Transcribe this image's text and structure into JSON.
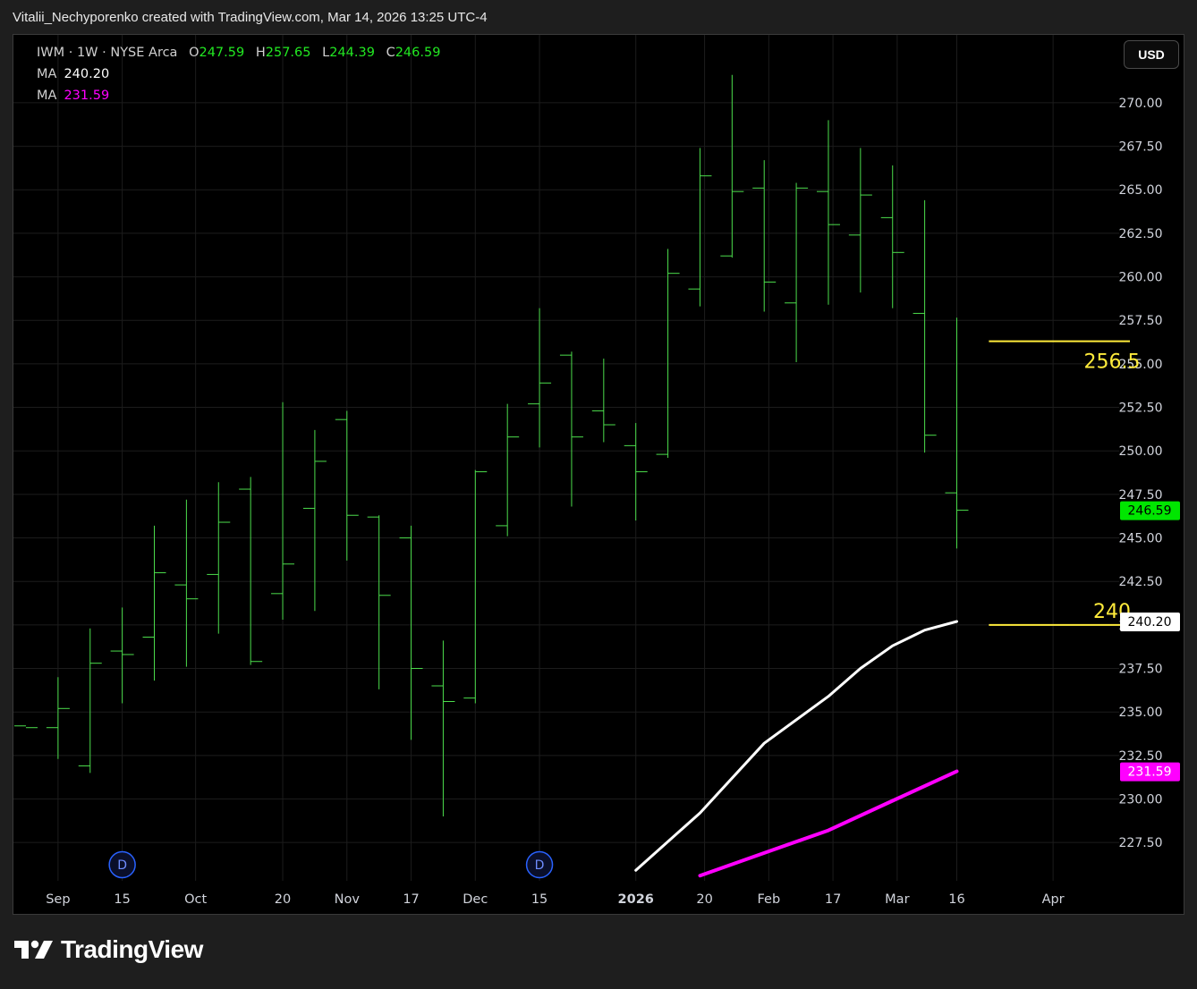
{
  "header": {
    "attribution": "Vitalii_Nechyporenko created with TradingView.com, Mar 14, 2026 13:25 UTC-4"
  },
  "legend": {
    "symbol": "IWM · 1W · NYSE Arca",
    "ohlc": {
      "o_label": "O",
      "o_value": "247.59",
      "h_label": "H",
      "h_value": "257.65",
      "l_label": "L",
      "l_value": "244.39",
      "c_label": "C",
      "c_value": "246.59"
    },
    "ma1_label": "MA",
    "ma1_value": "240.20",
    "ma2_label": "MA",
    "ma2_value": "231.59"
  },
  "toolbar": {
    "currency_button": "USD"
  },
  "branding": {
    "logo_text": "TradingView"
  },
  "colors": {
    "background": "#000000",
    "bar": "#4cdd4c",
    "ma1": "#ffffff",
    "ma2": "#ff00ff",
    "horizontal_line": "#ffeb3b",
    "last_price_badge": "#00e600",
    "dividend_marker": "#2962ff",
    "grid": "#1c1c1c"
  },
  "chart_data": {
    "type": "ohlc",
    "symbol": "IWM",
    "interval": "1W",
    "grid": true,
    "y_axis": {
      "range": [
        225.3,
        273.9
      ],
      "ticks": [
        "227.50",
        "230.00",
        "232.50",
        "235.00",
        "237.50",
        "240.00",
        "242.50",
        "245.00",
        "247.50",
        "250.00",
        "252.50",
        "255.00",
        "257.50",
        "260.00",
        "262.50",
        "265.00",
        "267.50",
        "270.00"
      ]
    },
    "x_axis": {
      "start": "2025-08-25",
      "end": "2026-04-13",
      "ticks": [
        {
          "label": "Sep",
          "date": "2025-09-01"
        },
        {
          "label": "15",
          "date": "2025-09-15"
        },
        {
          "label": "Oct",
          "date": "2025-10-01"
        },
        {
          "label": "20",
          "date": "2025-10-20"
        },
        {
          "label": "Nov",
          "date": "2025-11-03"
        },
        {
          "label": "17",
          "date": "2025-11-17"
        },
        {
          "label": "Dec",
          "date": "2025-12-01"
        },
        {
          "label": "15",
          "date": "2025-12-15"
        },
        {
          "label": "2026",
          "date": "2026-01-05"
        },
        {
          "label": "20",
          "date": "2026-01-20"
        },
        {
          "label": "Feb",
          "date": "2026-02-03"
        },
        {
          "label": "17",
          "date": "2026-02-17"
        },
        {
          "label": "Mar",
          "date": "2026-03-03"
        },
        {
          "label": "16",
          "date": "2026-03-16"
        },
        {
          "label": "Apr",
          "date": "2026-04-06"
        }
      ]
    },
    "bars": [
      {
        "date": "2025-08-25",
        "o": 234.2,
        "h": 234.2,
        "l": 234.2,
        "c": 234.1
      },
      {
        "date": "2025-09-01",
        "o": 234.1,
        "h": 237.0,
        "l": 232.3,
        "c": 235.2
      },
      {
        "date": "2025-09-08",
        "o": 231.9,
        "h": 239.8,
        "l": 231.5,
        "c": 237.8
      },
      {
        "date": "2025-09-15",
        "o": 238.5,
        "h": 241.0,
        "l": 235.5,
        "c": 238.3
      },
      {
        "date": "2025-09-22",
        "o": 239.3,
        "h": 245.7,
        "l": 236.8,
        "c": 243.0
      },
      {
        "date": "2025-09-29",
        "o": 242.3,
        "h": 247.2,
        "l": 237.6,
        "c": 241.5
      },
      {
        "date": "2025-10-06",
        "o": 242.9,
        "h": 248.2,
        "l": 239.5,
        "c": 245.9
      },
      {
        "date": "2025-10-13",
        "o": 247.8,
        "h": 248.5,
        "l": 237.7,
        "c": 237.9
      },
      {
        "date": "2025-10-20",
        "o": 241.8,
        "h": 252.8,
        "l": 240.3,
        "c": 243.5
      },
      {
        "date": "2025-10-27",
        "o": 246.7,
        "h": 251.2,
        "l": 240.8,
        "c": 249.4
      },
      {
        "date": "2025-11-03",
        "o": 251.8,
        "h": 252.3,
        "l": 243.7,
        "c": 246.3
      },
      {
        "date": "2025-11-10",
        "o": 246.2,
        "h": 246.3,
        "l": 236.3,
        "c": 241.7
      },
      {
        "date": "2025-11-17",
        "o": 245.0,
        "h": 245.7,
        "l": 233.4,
        "c": 237.5
      },
      {
        "date": "2025-11-24",
        "o": 236.5,
        "h": 239.1,
        "l": 229.0,
        "c": 235.6
      },
      {
        "date": "2025-12-01",
        "o": 235.8,
        "h": 248.9,
        "l": 235.5,
        "c": 248.8
      },
      {
        "date": "2025-12-08",
        "o": 245.7,
        "h": 252.7,
        "l": 245.1,
        "c": 250.8
      },
      {
        "date": "2025-12-15",
        "o": 252.7,
        "h": 258.2,
        "l": 250.2,
        "c": 253.9
      },
      {
        "date": "2025-12-22",
        "o": 255.5,
        "h": 255.7,
        "l": 246.8,
        "c": 250.8
      },
      {
        "date": "2025-12-29",
        "o": 252.3,
        "h": 255.3,
        "l": 250.5,
        "c": 251.5
      },
      {
        "date": "2026-01-05",
        "o": 250.3,
        "h": 251.6,
        "l": 246.0,
        "c": 248.8
      },
      {
        "date": "2026-01-12",
        "o": 249.8,
        "h": 261.6,
        "l": 249.6,
        "c": 260.2
      },
      {
        "date": "2026-01-19",
        "o": 259.3,
        "h": 267.4,
        "l": 258.3,
        "c": 265.8
      },
      {
        "date": "2026-01-26",
        "o": 261.2,
        "h": 271.6,
        "l": 261.1,
        "c": 264.9
      },
      {
        "date": "2026-02-02",
        "o": 265.1,
        "h": 266.7,
        "l": 258.0,
        "c": 259.7
      },
      {
        "date": "2026-02-09",
        "o": 258.5,
        "h": 265.4,
        "l": 255.1,
        "c": 265.1
      },
      {
        "date": "2026-02-16",
        "o": 264.9,
        "h": 269.0,
        "l": 258.4,
        "c": 263.0
      },
      {
        "date": "2026-02-23",
        "o": 262.4,
        "h": 267.4,
        "l": 259.1,
        "c": 264.7
      },
      {
        "date": "2026-03-02",
        "o": 263.4,
        "h": 266.4,
        "l": 258.2,
        "c": 261.4
      },
      {
        "date": "2026-03-09",
        "o": 257.9,
        "h": 264.4,
        "l": 249.9,
        "c": 250.9
      },
      {
        "date": "2026-03-16",
        "o": 247.59,
        "h": 257.65,
        "l": 244.39,
        "c": 246.59
      }
    ],
    "series": [
      {
        "name": "MA",
        "last_value": 240.2,
        "points": [
          {
            "date": "2026-01-05",
            "value": 225.9
          },
          {
            "date": "2026-01-19",
            "value": 229.2
          },
          {
            "date": "2026-02-02",
            "value": 233.2
          },
          {
            "date": "2026-02-16",
            "value": 235.9
          },
          {
            "date": "2026-02-23",
            "value": 237.5
          },
          {
            "date": "2026-03-02",
            "value": 238.8
          },
          {
            "date": "2026-03-09",
            "value": 239.7
          },
          {
            "date": "2026-03-16",
            "value": 240.2
          }
        ]
      },
      {
        "name": "MA",
        "last_value": 231.59,
        "points": [
          {
            "date": "2026-01-19",
            "value": 225.6
          },
          {
            "date": "2026-02-02",
            "value": 226.9
          },
          {
            "date": "2026-02-16",
            "value": 228.2
          },
          {
            "date": "2026-03-02",
            "value": 229.9
          },
          {
            "date": "2026-03-16",
            "value": 231.59
          }
        ]
      }
    ],
    "horizontal_lines": [
      {
        "value": 256.3,
        "label": "256.5",
        "start": "2026-03-23"
      },
      {
        "value": 240.0,
        "label": "240",
        "start": "2026-03-23"
      }
    ],
    "price_badges": [
      {
        "value": 246.59,
        "label": "246.59",
        "color": "#00e600",
        "text_color": "#000000"
      },
      {
        "value": 240.2,
        "label": "240.20",
        "color": "#ffffff",
        "text_color": "#000000"
      },
      {
        "value": 231.59,
        "label": "231.59",
        "color": "#ff00ff",
        "text_color": "#ffffff"
      }
    ],
    "dividend_markers": [
      {
        "date": "2025-09-15",
        "label": "D"
      },
      {
        "date": "2025-12-15",
        "label": "D"
      }
    ]
  }
}
